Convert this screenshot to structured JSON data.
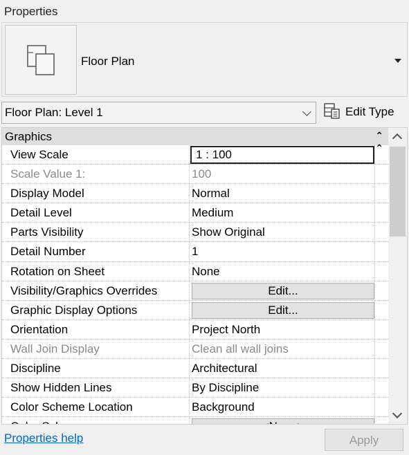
{
  "panel": {
    "title": "Properties"
  },
  "type_selector": {
    "name": "Floor Plan",
    "thumb_icon": "floor-plan-icon"
  },
  "instance": {
    "selected": "Floor Plan: Level 1",
    "edit_type_label": "Edit Type"
  },
  "group": {
    "label": "Graphics"
  },
  "rows": [
    {
      "name": "View Scale",
      "value": "1 : 100",
      "state": "focused"
    },
    {
      "name": "Scale Value    1:",
      "value": "100",
      "state": "disabled"
    },
    {
      "name": "Display Model",
      "value": "Normal"
    },
    {
      "name": "Detail Level",
      "value": "Medium"
    },
    {
      "name": "Parts Visibility",
      "value": "Show Original"
    },
    {
      "name": "Detail Number",
      "value": "1"
    },
    {
      "name": "Rotation on Sheet",
      "value": "None"
    },
    {
      "name": "Visibility/Graphics Overrides",
      "button": "Edit..."
    },
    {
      "name": "Graphic Display Options",
      "button": "Edit..."
    },
    {
      "name": "Orientation",
      "value": "Project North"
    },
    {
      "name": "Wall Join Display",
      "value": "Clean all wall joins",
      "state": "disabled"
    },
    {
      "name": "Discipline",
      "value": "Architectural"
    },
    {
      "name": "Show Hidden Lines",
      "value": "By Discipline"
    },
    {
      "name": "Color Scheme Location",
      "value": "Background"
    },
    {
      "name": "Color Scheme",
      "button": "<None>"
    }
  ],
  "footer": {
    "help_link": "Properties help",
    "apply_label": "Apply"
  }
}
